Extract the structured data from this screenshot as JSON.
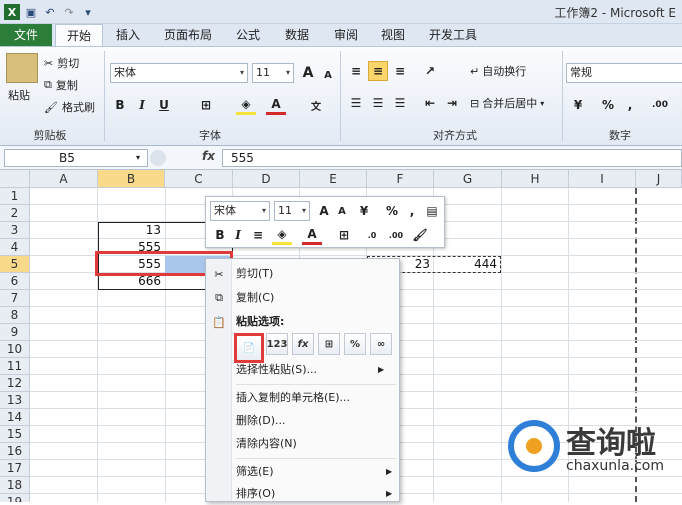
{
  "window": {
    "title": "工作簿2 - Microsoft E"
  },
  "quick_access": {
    "excel_icon": "excel-icon",
    "save_icon": "save-icon",
    "undo_icon": "undo-icon",
    "redo_icon": "redo-icon",
    "customize_icon": "customize-icon"
  },
  "tabs": [
    {
      "label": "文件"
    },
    {
      "label": "开始"
    },
    {
      "label": "插入"
    },
    {
      "label": "页面布局"
    },
    {
      "label": "公式"
    },
    {
      "label": "数据"
    },
    {
      "label": "审阅"
    },
    {
      "label": "视图"
    },
    {
      "label": "开发工具"
    }
  ],
  "ribbon": {
    "clipboard": {
      "paste": "粘贴",
      "cut": "剪切",
      "copy": "复制",
      "format_painter": "格式刷",
      "label": "剪贴板"
    },
    "font": {
      "name": "宋体",
      "size": "11",
      "label": "字体",
      "bold": "B",
      "italic": "I",
      "underline": "U",
      "grow": "A",
      "shrink": "A"
    },
    "alignment": {
      "wrap": "自动换行",
      "merge": "合并后居中",
      "label": "对齐方式"
    },
    "number": {
      "format": "常规",
      "label": "数字",
      "percent": "%",
      "comma": ","
    }
  },
  "formula_bar": {
    "name_box": "B5",
    "fx": "fx",
    "value": "555"
  },
  "columns": [
    "A",
    "B",
    "C",
    "D",
    "E",
    "F",
    "G",
    "H",
    "I",
    "J"
  ],
  "rows": [
    "1",
    "2",
    "3",
    "4",
    "5",
    "6",
    "7",
    "8",
    "9",
    "10",
    "11",
    "12",
    "13",
    "14",
    "15",
    "16",
    "17",
    "18",
    "19"
  ],
  "cells": {
    "B3": "13",
    "B4": "555",
    "B5": "555",
    "B6": "666",
    "F5": "23",
    "G5": "444"
  },
  "mini_toolbar": {
    "font": "宋体",
    "size": "11",
    "percent": "%",
    "comma": ",",
    "bold": "B",
    "italic": "I"
  },
  "context_menu": {
    "items": [
      {
        "label": "剪切(T)",
        "icon": "scissors-icon"
      },
      {
        "label": "复制(C)",
        "icon": "copy-icon"
      },
      {
        "label": "粘贴选项:",
        "icon": "paste-icon"
      },
      {
        "label": "选择性粘贴(S)...",
        "icon": ""
      },
      {
        "label": "插入复制的单元格(E)...",
        "icon": ""
      },
      {
        "label": "删除(D)...",
        "icon": ""
      },
      {
        "label": "清除内容(N)",
        "icon": ""
      },
      {
        "label": "筛选(E)",
        "icon": ""
      },
      {
        "label": "排序(O)",
        "icon": ""
      }
    ],
    "paste_options": [
      "paste",
      "123",
      "fx",
      "paste-formatting",
      "%",
      "link"
    ]
  },
  "watermark": {
    "text": "查询啦",
    "url": "chaxunla.com"
  },
  "colors": {
    "file_tab": "#2d7d3a",
    "selection": "#f9d98a",
    "highlight_box": "#e03a3a",
    "logo_blue": "#2f7fd8"
  }
}
